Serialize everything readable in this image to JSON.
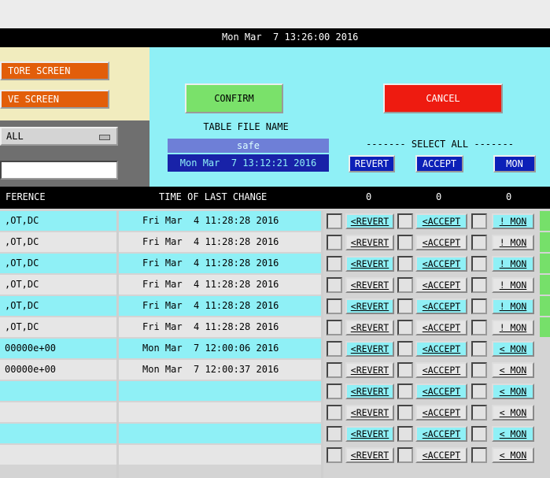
{
  "banner": {
    "datetime": "Mon Mar  7 13:26:00 2016"
  },
  "left_panel": {
    "restore_label": "TORE SCREEN",
    "save_label": "VE SCREEN",
    "dropdown_value": "ALL",
    "text_field_value": ""
  },
  "control": {
    "confirm_label": "CONFIRM",
    "cancel_label": "CANCEL",
    "table_file_label": "TABLE FILE NAME",
    "table_file_value": "safe",
    "table_file_time": "Mon Mar  7 13:12:21 2016",
    "select_all_label": "------- SELECT ALL -------",
    "revert_all_label": "REVERT",
    "accept_all_label": "ACCEPT",
    "mon_all_label": "MON"
  },
  "header": {
    "reference": "FERENCE",
    "time_of_last_change": "TIME OF LAST CHANGE",
    "count_revert": "0",
    "count_accept": "0",
    "count_mon": "0"
  },
  "rows": [
    {
      "ref": ",OT,DC",
      "time": "Fri Mar  4 11:28:28 2016",
      "revert": "<REVERT",
      "accept": "<ACCEPT",
      "mon": "! MON",
      "bg": "#8ff0f6"
    },
    {
      "ref": ",OT,DC",
      "time": "Fri Mar  4 11:28:28 2016",
      "revert": "<REVERT",
      "accept": "<ACCEPT",
      "mon": "! MON",
      "bg": "#e6e6e6"
    },
    {
      "ref": ",OT,DC",
      "time": "Fri Mar  4 11:28:28 2016",
      "revert": "<REVERT",
      "accept": "<ACCEPT",
      "mon": "! MON",
      "bg": "#8ff0f6"
    },
    {
      "ref": ",OT,DC",
      "time": "Fri Mar  4 11:28:28 2016",
      "revert": "<REVERT",
      "accept": "<ACCEPT",
      "mon": "! MON",
      "bg": "#e6e6e6"
    },
    {
      "ref": ",OT,DC",
      "time": "Fri Mar  4 11:28:28 2016",
      "revert": "<REVERT",
      "accept": "<ACCEPT",
      "mon": "! MON",
      "bg": "#8ff0f6"
    },
    {
      "ref": ",OT,DC",
      "time": "Fri Mar  4 11:28:28 2016",
      "revert": "<REVERT",
      "accept": "<ACCEPT",
      "mon": "! MON",
      "bg": "#e6e6e6"
    },
    {
      "ref": "00000e+00",
      "time": "Mon Mar  7 12:00:06 2016",
      "revert": "<REVERT",
      "accept": "<ACCEPT",
      "mon": "< MON",
      "bg": "#8ff0f6"
    },
    {
      "ref": "00000e+00",
      "time": "Mon Mar  7 12:00:37 2016",
      "revert": "<REVERT",
      "accept": "<ACCEPT",
      "mon": "< MON",
      "bg": "#e6e6e6"
    },
    {
      "ref": "",
      "time": "",
      "revert": "<REVERT",
      "accept": "<ACCEPT",
      "mon": "< MON",
      "bg": "#8ff0f6"
    },
    {
      "ref": "",
      "time": "",
      "revert": "<REVERT",
      "accept": "<ACCEPT",
      "mon": "< MON",
      "bg": "#e6e6e6"
    },
    {
      "ref": "",
      "time": "",
      "revert": "<REVERT",
      "accept": "<ACCEPT",
      "mon": "< MON",
      "bg": "#8ff0f6"
    },
    {
      "ref": "",
      "time": "",
      "revert": "<REVERT",
      "accept": "<ACCEPT",
      "mon": "< MON",
      "bg": "#e6e6e6"
    }
  ],
  "colors": {
    "cyan_row": "#8ff0f6",
    "grey_row": "#e6e6e6",
    "orange_button": "#e25e0a",
    "green_button": "#7ae16a",
    "red_button": "#ee1b10",
    "navy_button": "#0c20b8",
    "status_green": "#76e06a"
  }
}
